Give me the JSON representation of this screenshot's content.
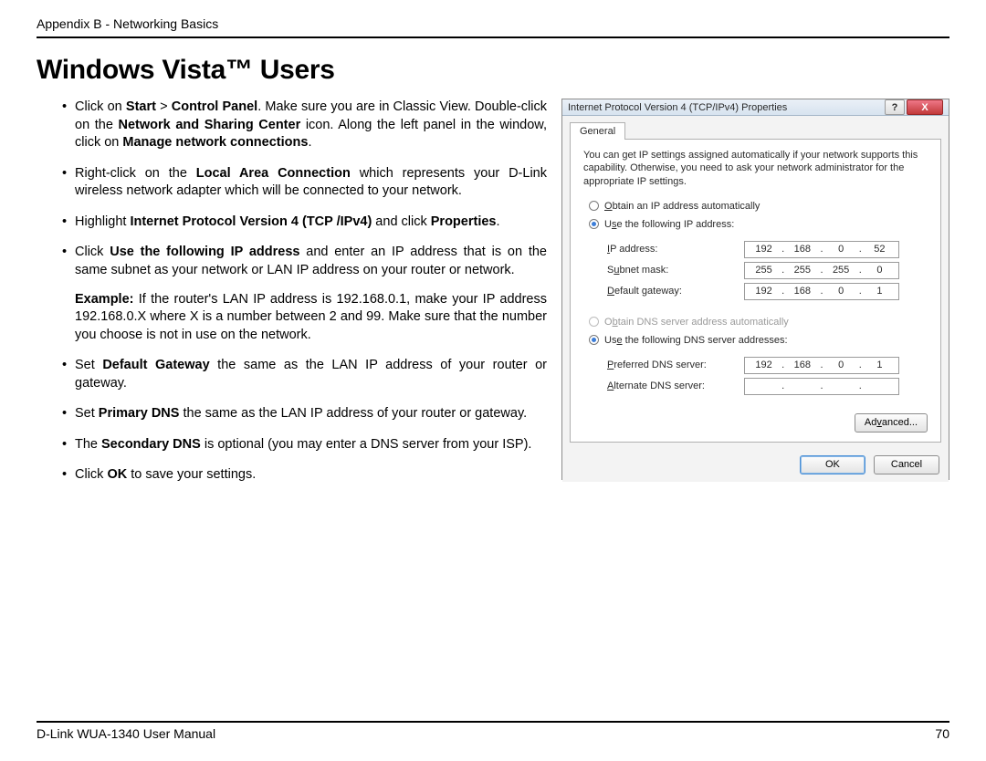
{
  "header": {
    "breadcrumb": "Appendix B - Networking Basics"
  },
  "title": "Windows Vista™ Users",
  "bullets": {
    "b1a": "Click on ",
    "b1b": "Start",
    "b1c": " > ",
    "b1d": "Control Panel",
    "b1e": ". Make sure you are in Classic View. Double-click on the ",
    "b1f": "Network and Sharing Center",
    "b1g": " icon. Along the left panel in the window, click on ",
    "b1h": "Manage network connections",
    "b1i": ".",
    "b2a": "Right-click on the ",
    "b2b": "Local Area Connection",
    "b2c": " which represents your D-Link wireless network adapter which will be connected to your network.",
    "b3a": "Highlight ",
    "b3b": "Internet Protocol Version 4 (TCP /IPv4)",
    "b3c": " and click ",
    "b3d": "Properties",
    "b3e": ".",
    "b4a": "Click ",
    "b4b": "Use the following IP address",
    "b4c": " and enter an IP address that is on the same subnet as your network or LAN IP address on your router or network.",
    "exa": "Example:",
    "exb": " If the router's LAN IP address is 192.168.0.1, make your IP address 192.168.0.X where X is a number between 2 and 99. Make sure that the number you choose is not in use on the network.",
    "b5a": "Set ",
    "b5b": "Default Gateway",
    "b5c": " the same as the LAN IP address of your router or gateway.",
    "b6a": "Set ",
    "b6b": "Primary DNS",
    "b6c": " the same as the LAN IP address of your router or gateway.",
    "b7a": "The ",
    "b7b": "Secondary DNS",
    "b7c": " is optional (you may enter a DNS server from your ISP).",
    "b8a": "Click ",
    "b8b": "OK",
    "b8c": " to save your settings."
  },
  "dialog": {
    "title": "Internet Protocol Version 4 (TCP/IPv4) Properties",
    "help": "?",
    "close": "X",
    "tab_general": "General",
    "desc": "You can get IP settings assigned automatically if your network supports this capability. Otherwise, you need to ask your network administrator for the appropriate IP settings.",
    "r_auto_ip": "Obtain an IP address automatically",
    "r_use_ip": "Use the following IP address:",
    "lbl_ip": "IP address:",
    "lbl_mask": "Subnet mask:",
    "lbl_gw": "Default gateway:",
    "ip": {
      "a": "192",
      "b": "168",
      "c": "0",
      "d": "52"
    },
    "mask": {
      "a": "255",
      "b": "255",
      "c": "255",
      "d": "0"
    },
    "gw": {
      "a": "192",
      "b": "168",
      "c": "0",
      "d": "1"
    },
    "r_auto_dns": "Obtain DNS server address automatically",
    "r_use_dns": "Use the following DNS server addresses:",
    "lbl_pdns": "Preferred DNS server:",
    "lbl_adns": "Alternate DNS server:",
    "pdns": {
      "a": "192",
      "b": "168",
      "c": "0",
      "d": "1"
    },
    "adv": "Advanced...",
    "ok": "OK",
    "cancel": "Cancel"
  },
  "footer": {
    "left": "D-Link WUA-1340 User Manual",
    "right": "70"
  }
}
